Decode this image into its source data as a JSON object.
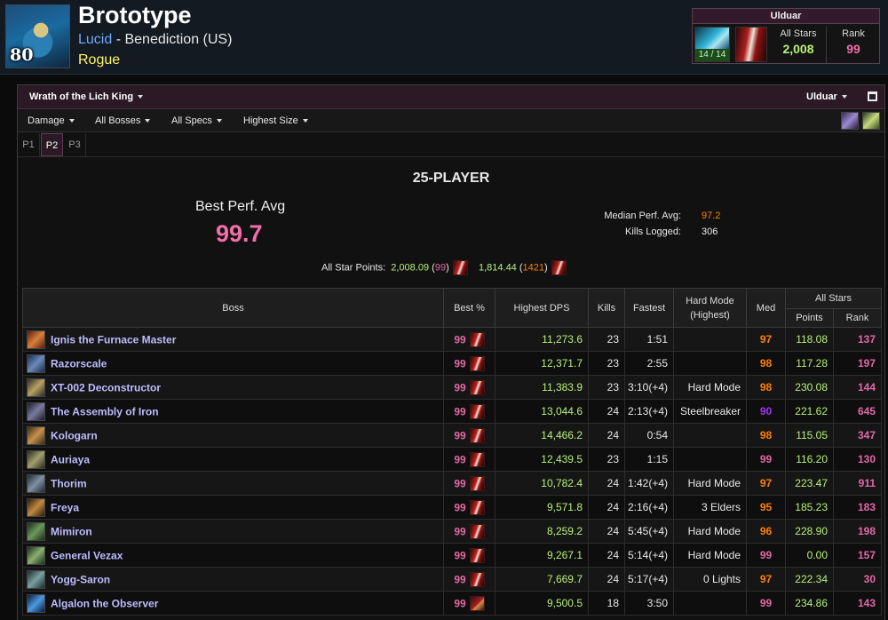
{
  "header": {
    "level": "80",
    "name": "Brototype",
    "guild": "Lucid",
    "realm_sep": " - ",
    "realm": "Benediction (US)",
    "class": "Rogue"
  },
  "zone_box": {
    "title": "Ulduar",
    "progress": "14 / 14",
    "all_stars_label": "All Stars",
    "all_stars_value": "2,008",
    "rank_label": "Rank",
    "rank_value": "99"
  },
  "panel": {
    "expansion": "Wrath of the Lich King",
    "zone": "Ulduar"
  },
  "filters": [
    "Damage",
    "All Bosses",
    "All Specs",
    "Highest Size"
  ],
  "phases": [
    "P1",
    "P2",
    "P3"
  ],
  "active_phase": "P2",
  "summary": {
    "size_title": "25-PLAYER",
    "best_perf_label": "Best Perf. Avg",
    "best_perf_value": "99.7",
    "median_label": "Median Perf. Avg:",
    "median_value": "97.2",
    "kills_label": "Kills Logged:",
    "kills_value": "306",
    "star_points_label": "All Star Points:",
    "star1_points": "2,008.09",
    "star1_rank": "99",
    "star2_points": "1,814.44",
    "star2_rank": "1421"
  },
  "table": {
    "headers": {
      "boss": "Boss",
      "best": "Best %",
      "dps": "Highest DPS",
      "kills": "Kills",
      "fastest": "Fastest",
      "hardmode": "Hard Mode",
      "hardmode_sub": "(Highest)",
      "med": "Med",
      "allstars": "All Stars",
      "points": "Points",
      "rank": "Rank"
    },
    "rows": [
      {
        "boss": "Ignis the Furnace Master",
        "best": "99",
        "dps": "11,273.6",
        "kills": "23",
        "fastest": "1:51",
        "hardmode": "",
        "med": "97",
        "points": "118.08",
        "rank": "137"
      },
      {
        "boss": "Razorscale",
        "best": "99",
        "dps": "12,371.7",
        "kills": "23",
        "fastest": "2:55",
        "hardmode": "",
        "med": "98",
        "points": "117.28",
        "rank": "197"
      },
      {
        "boss": "XT-002 Deconstructor",
        "best": "99",
        "dps": "11,383.9",
        "kills": "23",
        "fastest": "3:10(+4)",
        "hardmode": "Hard Mode",
        "med": "98",
        "points": "230.08",
        "rank": "144"
      },
      {
        "boss": "The Assembly of Iron",
        "best": "99",
        "dps": "13,044.6",
        "kills": "24",
        "fastest": "2:13(+4)",
        "hardmode": "Steelbreaker",
        "med": "90",
        "points": "221.62",
        "rank": "645"
      },
      {
        "boss": "Kologarn",
        "best": "99",
        "dps": "14,466.2",
        "kills": "24",
        "fastest": "0:54",
        "hardmode": "",
        "med": "98",
        "points": "115.05",
        "rank": "347"
      },
      {
        "boss": "Auriaya",
        "best": "99",
        "dps": "12,439.5",
        "kills": "23",
        "fastest": "1:15",
        "hardmode": "",
        "med": "99",
        "points": "116.20",
        "rank": "130"
      },
      {
        "boss": "Thorim",
        "best": "99",
        "dps": "10,782.4",
        "kills": "24",
        "fastest": "1:42(+4)",
        "hardmode": "Hard Mode",
        "med": "97",
        "points": "223.47",
        "rank": "911"
      },
      {
        "boss": "Freya",
        "best": "99",
        "dps": "9,571.8",
        "kills": "24",
        "fastest": "2:16(+4)",
        "hardmode": "3 Elders",
        "med": "95",
        "points": "185.23",
        "rank": "183"
      },
      {
        "boss": "Mimiron",
        "best": "99",
        "dps": "8,259.2",
        "kills": "24",
        "fastest": "5:45(+4)",
        "hardmode": "Hard Mode",
        "med": "96",
        "points": "228.90",
        "rank": "198"
      },
      {
        "boss": "General Vezax",
        "best": "99",
        "dps": "9,267.1",
        "kills": "24",
        "fastest": "5:14(+4)",
        "hardmode": "Hard Mode",
        "med": "99",
        "points": "0.00",
        "rank": "157"
      },
      {
        "boss": "Yogg-Saron",
        "best": "99",
        "dps": "7,669.7",
        "kills": "24",
        "fastest": "5:17(+4)",
        "hardmode": "0 Lights",
        "med": "97",
        "points": "222.34",
        "rank": "30"
      },
      {
        "boss": "Algalon the Observer",
        "best": "99",
        "dps": "9,500.5",
        "kills": "18",
        "fastest": "3:50",
        "hardmode": "",
        "med": "99",
        "points": "234.86",
        "rank": "143"
      }
    ]
  }
}
